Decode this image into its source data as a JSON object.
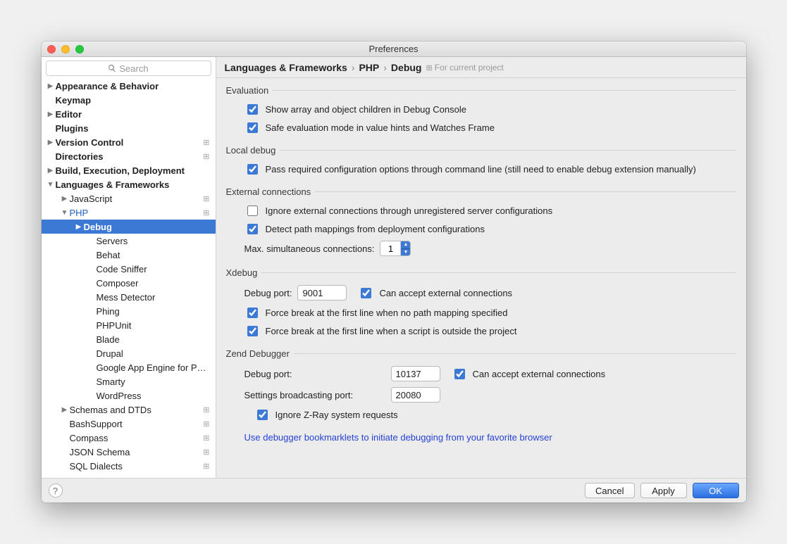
{
  "title": "Preferences",
  "search_placeholder": "Search",
  "breadcrumb": {
    "a": "Languages & Frameworks",
    "b": "PHP",
    "c": "Debug",
    "hint": "For current project"
  },
  "sidebar": [
    {
      "label": "Appearance & Behavior",
      "depth": 0,
      "bold": true,
      "arrow": "right"
    },
    {
      "label": "Keymap",
      "depth": 0,
      "bold": true
    },
    {
      "label": "Editor",
      "depth": 0,
      "bold": true,
      "arrow": "right"
    },
    {
      "label": "Plugins",
      "depth": 0,
      "bold": true
    },
    {
      "label": "Version Control",
      "depth": 0,
      "bold": true,
      "arrow": "right",
      "tag": true
    },
    {
      "label": "Directories",
      "depth": 0,
      "bold": true,
      "tag": true
    },
    {
      "label": "Build, Execution, Deployment",
      "depth": 0,
      "bold": true,
      "arrow": "right"
    },
    {
      "label": "Languages & Frameworks",
      "depth": 0,
      "bold": true,
      "arrow": "down"
    },
    {
      "label": "JavaScript",
      "depth": 1,
      "arrow": "right",
      "tag": true
    },
    {
      "label": "PHP",
      "depth": 1,
      "arrow": "down",
      "blue": true,
      "tag": true
    },
    {
      "label": "Debug",
      "depth": 2,
      "arrow": "right",
      "selected": true
    },
    {
      "label": "Servers",
      "depth": 3
    },
    {
      "label": "Behat",
      "depth": 3
    },
    {
      "label": "Code Sniffer",
      "depth": 3
    },
    {
      "label": "Composer",
      "depth": 3
    },
    {
      "label": "Mess Detector",
      "depth": 3
    },
    {
      "label": "Phing",
      "depth": 3
    },
    {
      "label": "PHPUnit",
      "depth": 3
    },
    {
      "label": "Blade",
      "depth": 3
    },
    {
      "label": "Drupal",
      "depth": 3
    },
    {
      "label": "Google App Engine for PHP",
      "depth": 3
    },
    {
      "label": "Smarty",
      "depth": 3
    },
    {
      "label": "WordPress",
      "depth": 3
    },
    {
      "label": "Schemas and DTDs",
      "depth": 1,
      "arrow": "right",
      "tag": true
    },
    {
      "label": "BashSupport",
      "depth": 1,
      "tag": true
    },
    {
      "label": "Compass",
      "depth": 1,
      "tag": true
    },
    {
      "label": "JSON Schema",
      "depth": 1,
      "tag": true
    },
    {
      "label": "SQL Dialects",
      "depth": 1,
      "tag": true
    }
  ],
  "sections": {
    "evaluation": {
      "title": "Evaluation",
      "opt1": "Show array and object children in Debug Console",
      "opt2": "Safe evaluation mode in value hints and Watches Frame"
    },
    "local_debug": {
      "title": "Local debug",
      "opt1": "Pass required configuration options through command line (still need to enable debug extension manually)"
    },
    "external": {
      "title": "External connections",
      "opt1": "Ignore external connections through unregistered server configurations",
      "opt2": "Detect path mappings from deployment configurations",
      "max_label": "Max. simultaneous connections:",
      "max_value": "1"
    },
    "xdebug": {
      "title": "Xdebug",
      "port_label": "Debug port:",
      "port_value": "9001",
      "accept": "Can accept external connections",
      "force1": "Force break at the first line when no path mapping specified",
      "force2": "Force break at the first line when a script is outside the project"
    },
    "zend": {
      "title": "Zend Debugger",
      "port_label": "Debug port:",
      "port_value": "10137",
      "accept": "Can accept external connections",
      "bport_label": "Settings broadcasting port:",
      "bport_value": "20080",
      "zray": "Ignore Z-Ray system requests"
    },
    "link": "Use debugger bookmarklets to initiate debugging from your favorite browser"
  },
  "footer": {
    "cancel": "Cancel",
    "apply": "Apply",
    "ok": "OK"
  }
}
